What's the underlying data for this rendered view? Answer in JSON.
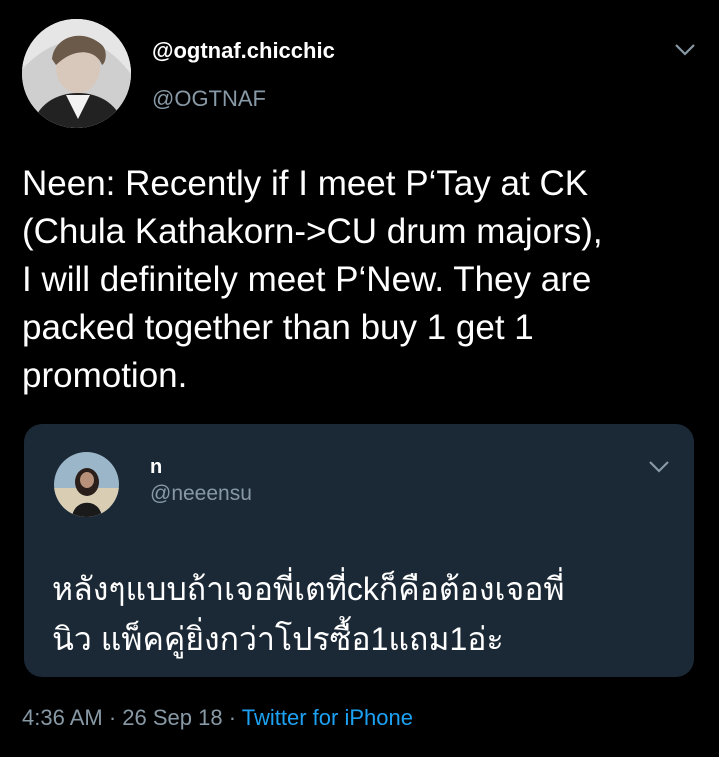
{
  "tweet": {
    "display_name": "@ogtnaf.chicchic",
    "handle": "@OGTNAF",
    "text": "Neen: Recently if I meet P‘Tay at CK\n(Chula Kathakorn->CU drum majors),\nI will definitely meet P‘New. They are\npacked together than buy 1 get 1\npromotion.",
    "time": "4:36 AM",
    "separator": "·",
    "date": "26 Sep 18",
    "source": "Twitter for iPhone"
  },
  "quoted_tweet": {
    "display_name": "n",
    "handle": "@neeensu",
    "text": "หลังๆแบบถ้าเจอพี่เตที่ckก็คือต้องเจอพี่\nนิว แพ็คคู่ยิ่งกว่าโปรซื้อ1แถม1อ่ะ"
  },
  "colors": {
    "background": "#000000",
    "quote_background": "#1b2835",
    "secondary_text": "#8899a6",
    "link": "#1da1f2"
  },
  "icons": [
    "avatar-image",
    "chevron-down-icon"
  ]
}
